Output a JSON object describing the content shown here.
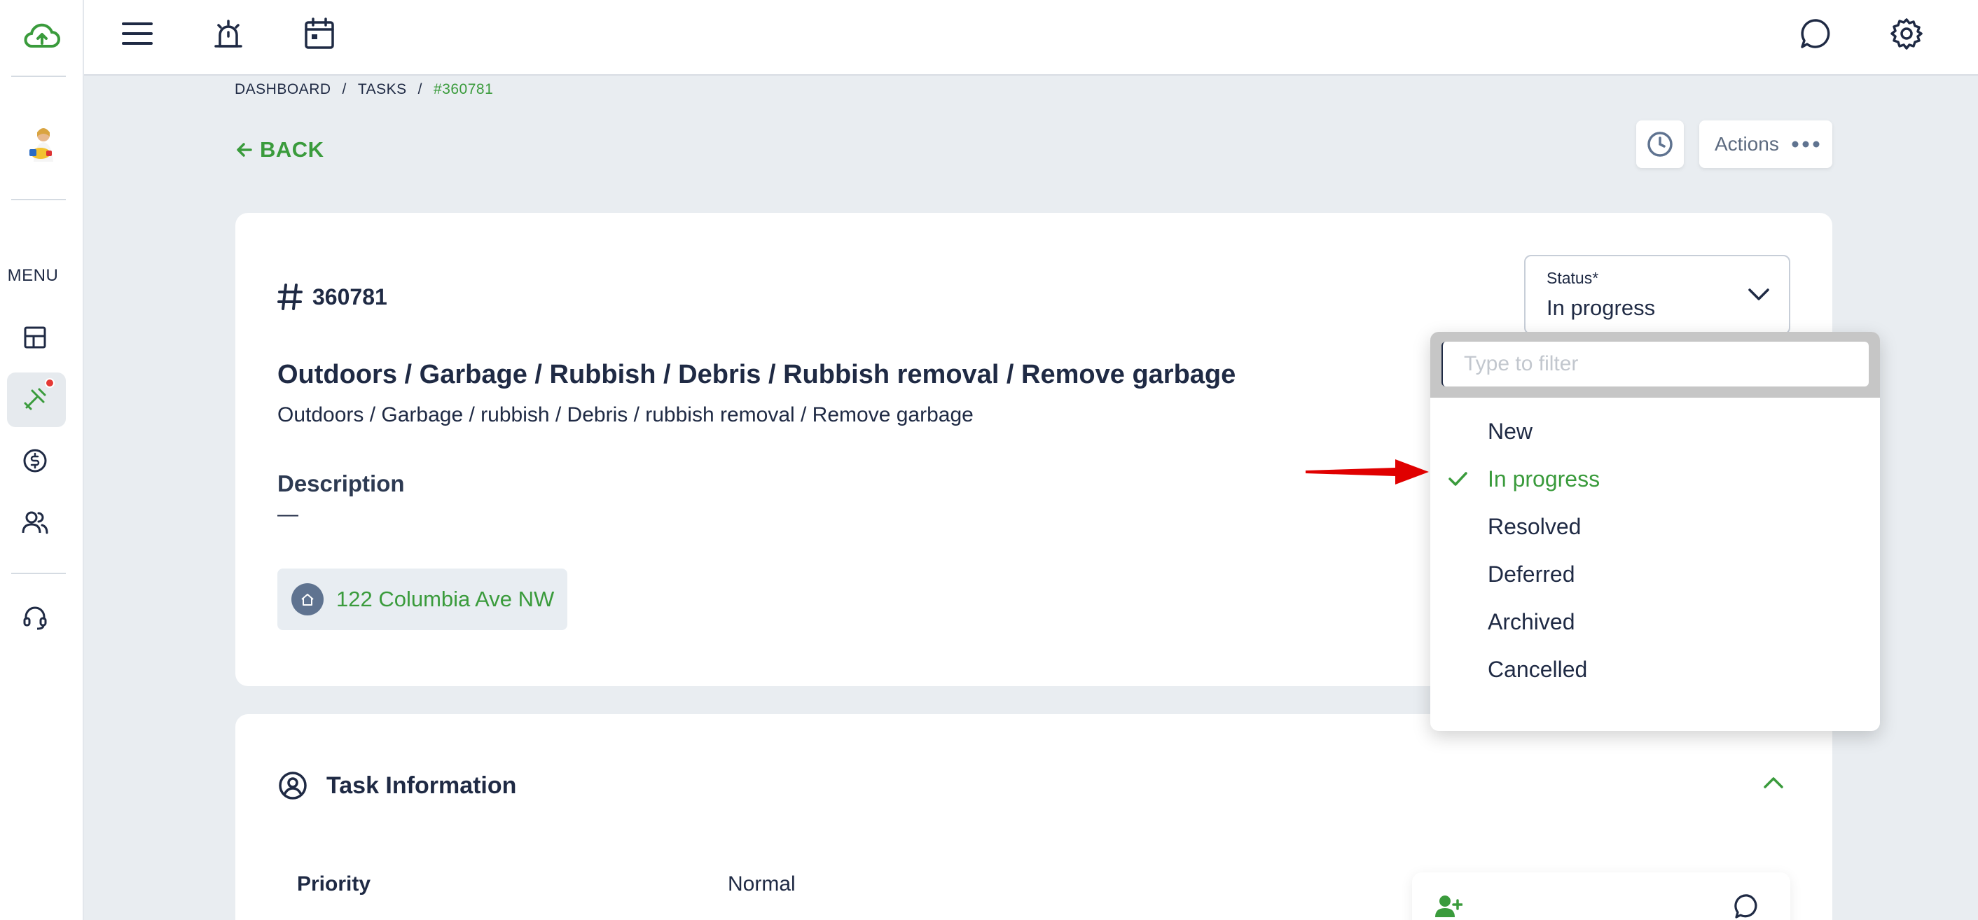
{
  "sidebar": {
    "menu_label": "MENU",
    "icons": [
      "cloud-upload-icon",
      "avatar",
      "dashboard-icon",
      "tools-icon",
      "dollar-icon",
      "users-icon",
      "headset-icon"
    ]
  },
  "topbar": {
    "icons": [
      "hamburger-menu-icon",
      "alarm-icon",
      "calendar-icon",
      "chat-icon",
      "gear-icon"
    ]
  },
  "breadcrumb": {
    "items": [
      "DASHBOARD",
      "TASKS",
      "#360781"
    ],
    "separator": "/"
  },
  "back_label": "BACK",
  "actions_label": "Actions",
  "task": {
    "number": "360781",
    "title": "Outdoors / Garbage / Rubbish / Debris / Rubbish removal / Remove garbage",
    "subtitle": "Outdoors / Garbage / rubbish / Debris / rubbish removal / Remove garbage",
    "description_label": "Description",
    "description_value": "—",
    "address": "122 Columbia Ave NW"
  },
  "status": {
    "label": "Status*",
    "value": "In progress",
    "filter_placeholder": "Type to filter",
    "options": [
      "New",
      "In progress",
      "Resolved",
      "Deferred",
      "Archived",
      "Cancelled"
    ],
    "selected_index": 1
  },
  "task_info": {
    "title": "Task Information",
    "priority_label": "Priority",
    "priority_value": "Normal"
  },
  "colors": {
    "accent_green": "#3a9b3c",
    "text_dark": "#1f2a44",
    "arrow_red": "#e00000"
  }
}
